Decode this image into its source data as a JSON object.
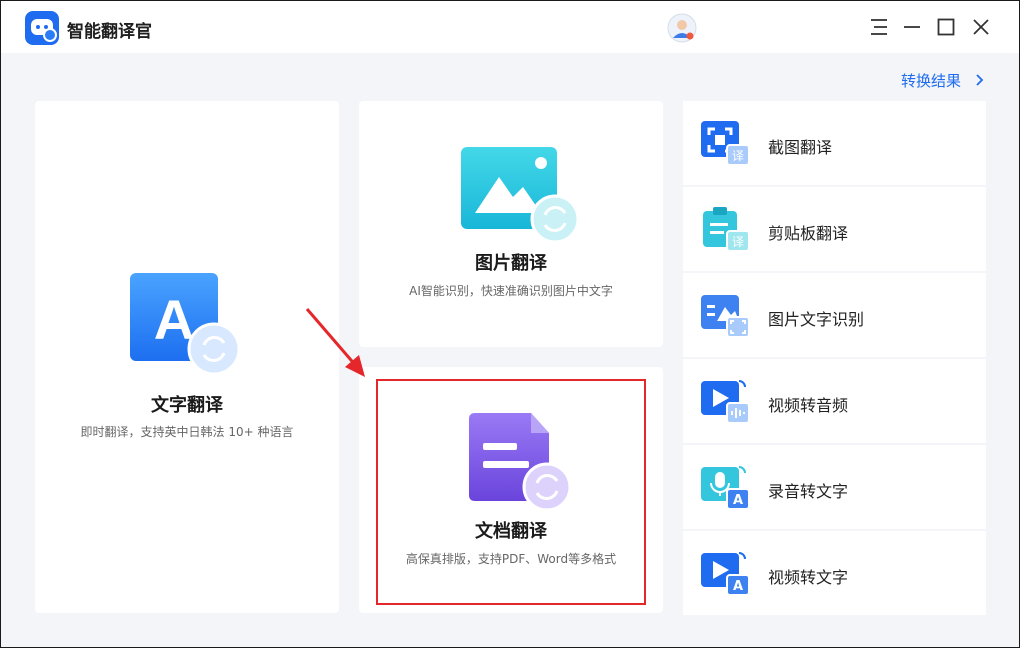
{
  "app": {
    "title": "智能翻译官"
  },
  "header": {
    "result_link": "转换结果"
  },
  "cards": {
    "text": {
      "title": "文字翻译",
      "desc": "即时翻译，支持英中日韩法 10+ 种语言",
      "icon_letter": "A"
    },
    "image": {
      "title": "图片翻译",
      "desc": "AI智能识别，快速准确识别图片中文字"
    },
    "doc": {
      "title": "文档翻译",
      "desc": "高保真排版，支持PDF、Word等多格式"
    }
  },
  "sidebar": {
    "items": [
      {
        "label": "截图翻译",
        "icon": "screenshot-translate-icon"
      },
      {
        "label": "剪贴板翻译",
        "icon": "clipboard-translate-icon"
      },
      {
        "label": "图片文字识别",
        "icon": "image-ocr-icon"
      },
      {
        "label": "视频转音频",
        "icon": "video-to-audio-icon"
      },
      {
        "label": "录音转文字",
        "icon": "recording-to-text-icon"
      },
      {
        "label": "视频转文字",
        "icon": "video-to-text-icon"
      }
    ],
    "badge_char": "译",
    "badge_letter": "A"
  },
  "colors": {
    "accent": "#1f6cf0",
    "highlight": "#e5262b",
    "doc_purple": "#7b55e0"
  }
}
